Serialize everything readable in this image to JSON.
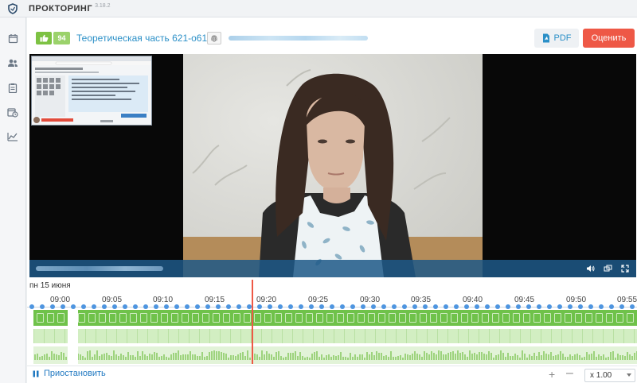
{
  "app": {
    "title": "ПРОКТОРИНГ",
    "version": "3.18.2"
  },
  "sidebar": {
    "items": [
      {
        "icon": "calendar-icon"
      },
      {
        "icon": "users-icon"
      },
      {
        "icon": "clipboard-icon"
      },
      {
        "icon": "schedule-icon"
      },
      {
        "icon": "chart-icon"
      }
    ]
  },
  "header": {
    "score": "94",
    "session_title": "Теоретическая часть 621-о61",
    "pdf_label": "PDF",
    "rate_label": "Оценить"
  },
  "timeline": {
    "date": "пн 15 июня",
    "ticks": [
      "09:00",
      "09:05",
      "09:10",
      "09:15",
      "09:20",
      "09:25",
      "09:30",
      "09:35",
      "09:40",
      "09:45",
      "09:50",
      "09:55"
    ]
  },
  "footer": {
    "pause_label": "Приостановить",
    "speed": "x 1.00"
  },
  "colors": {
    "accent": "#2a8fc7",
    "danger": "#ee5846",
    "ok": "#7dc243",
    "timeline_green": "#6fc24a",
    "video_bar": "#1d5887"
  }
}
